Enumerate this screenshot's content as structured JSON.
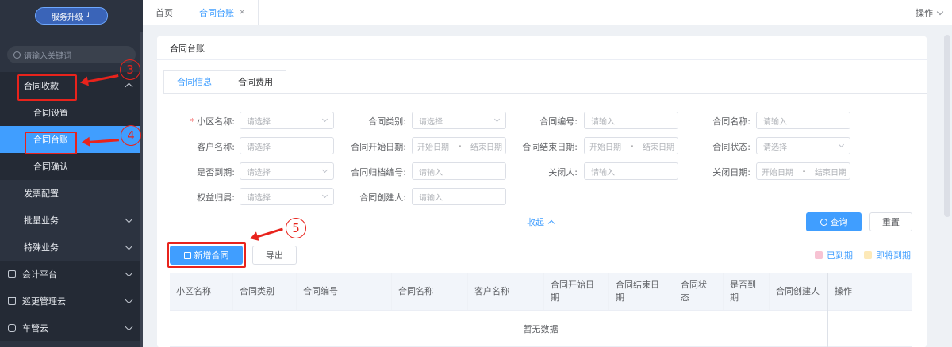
{
  "sidebar": {
    "upgrade_label": "服务升级",
    "upgrade_icon": "refresh-icon",
    "search_placeholder": "请输入关键词",
    "items": [
      {
        "label": "合同收款"
      },
      {
        "label": "合同设置"
      },
      {
        "label": "合同台账"
      },
      {
        "label": "合同确认"
      },
      {
        "label": "发票配置"
      },
      {
        "label": "批量业务"
      },
      {
        "label": "特殊业务"
      },
      {
        "label": "会计平台"
      },
      {
        "label": "巡更管理云"
      },
      {
        "label": "车管云"
      }
    ]
  },
  "tabs": {
    "home": "首页",
    "current": "合同台账",
    "close": "×",
    "operation": "操作"
  },
  "card": {
    "title": "合同台账",
    "subtabs": [
      "合同信息",
      "合同费用"
    ]
  },
  "form": {
    "community_label": "小区名称:",
    "community_placeholder": "请选择",
    "type_label": "合同类别:",
    "type_placeholder": "请选择",
    "number_label": "合同编号:",
    "number_placeholder": "请输入",
    "name_label": "合同名称:",
    "name_placeholder": "请输入",
    "customer_label": "客户名称:",
    "customer_placeholder": "请选择",
    "start_label": "合同开始日期:",
    "end_label": "合同结束日期:",
    "start_date_placeholder": "开始日期",
    "end_date_placeholder": "结束日期",
    "range_sep": "-",
    "status_label": "合同状态:",
    "status_placeholder": "请选择",
    "expired_label": "是否到期:",
    "expired_placeholder": "请选择",
    "archive_label": "合同归档编号:",
    "archive_placeholder": "请输入",
    "closer_label": "关闭人:",
    "closer_placeholder": "请输入",
    "close_date_label": "关闭日期:",
    "rights_label": "权益归属:",
    "rights_placeholder": "请选择",
    "creator_label": "合同创建人:",
    "creator_placeholder": "请输入",
    "required_mark": "*"
  },
  "actions": {
    "collapse": "收起",
    "query": "查询",
    "reset": "重置",
    "add": "新增合同",
    "export": "导出"
  },
  "legend": {
    "expired": "已到期",
    "expiring": "即将到期",
    "expired_color": "#f7c3d3",
    "expiring_color": "#fde9b8"
  },
  "table": {
    "columns": [
      "小区名称",
      "合同类别",
      "合同编号",
      "合同名称",
      "客户名称",
      "合同开始日\n期",
      "合同结束日\n期",
      "合同状\n态",
      "是否到\n期",
      "合同创建人",
      "操作"
    ],
    "empty": "暂无数据"
  },
  "annotations": [
    "3",
    "4",
    "5"
  ]
}
